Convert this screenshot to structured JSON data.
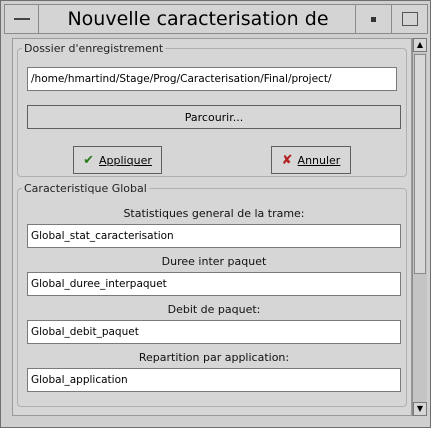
{
  "window": {
    "title": "Nouvelle caracterisation de trace"
  },
  "folder_group": {
    "legend": "Dossier d'enregistrement",
    "path_value": "/home/hmartind/Stage/Prog/Caracterisation/Final/project/",
    "browse_label": "Parcourir..."
  },
  "actions": {
    "apply_label": "Appliquer",
    "cancel_label": "Annuler"
  },
  "global_group": {
    "legend": "Caracteristique Global",
    "items": [
      {
        "caption": "Statistiques general de la trame:",
        "value": "Global_stat_caracterisation"
      },
      {
        "caption": "Duree inter paquet",
        "value": "Global_duree_interpaquet"
      },
      {
        "caption": "Debit de paquet:",
        "value": "Global_debit_paquet"
      },
      {
        "caption": "Repartition par application:",
        "value": "Global_application"
      }
    ]
  }
}
